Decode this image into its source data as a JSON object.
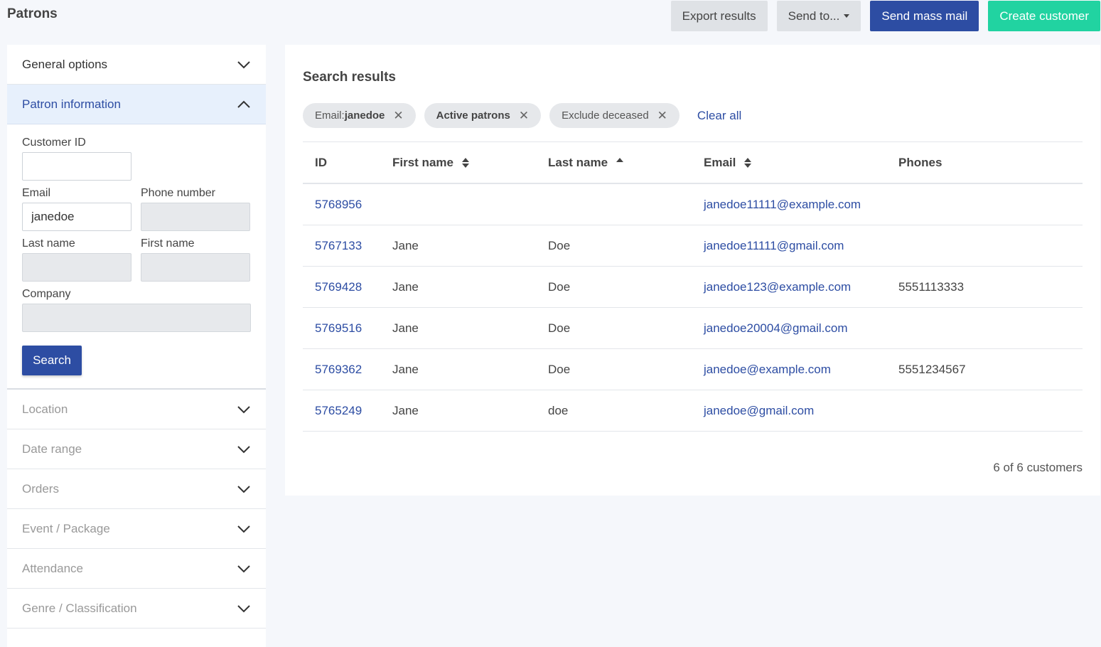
{
  "page_title": "Patrons",
  "actions": {
    "export": "Export results",
    "send_to": "Send to...",
    "mass_mail": "Send mass mail",
    "create": "Create customer"
  },
  "sidebar": {
    "general_options": "General options",
    "patron_information": "Patron information",
    "labels": {
      "customer_id": "Customer ID",
      "email": "Email",
      "phone": "Phone number",
      "last_name": "Last name",
      "first_name": "First name",
      "company": "Company"
    },
    "values": {
      "customer_id": "",
      "email": "janedoe",
      "phone": "",
      "last_name": "",
      "first_name": "",
      "company": ""
    },
    "search_button": "Search",
    "sections": [
      "Location",
      "Date range",
      "Orders",
      "Event / Package",
      "Attendance",
      "Genre / Classification"
    ]
  },
  "results": {
    "title": "Search results",
    "filters": [
      {
        "prefix": "Email: ",
        "bold": "janedoe"
      },
      {
        "prefix": "",
        "bold": "Active patrons"
      },
      {
        "prefix": "Exclude deceased",
        "bold": ""
      }
    ],
    "clear_all": "Clear all",
    "columns": {
      "id": "ID",
      "first_name": "First name",
      "last_name": "Last name",
      "email": "Email",
      "phones": "Phones"
    },
    "rows": [
      {
        "id": "5768956",
        "first": "",
        "last": "",
        "email": "janedoe11111@example.com",
        "phone": ""
      },
      {
        "id": "5767133",
        "first": "Jane",
        "last": "Doe",
        "email": "janedoe11111@gmail.com",
        "phone": ""
      },
      {
        "id": "5769428",
        "first": "Jane",
        "last": "Doe",
        "email": "janedoe123@example.com",
        "phone": "5551113333"
      },
      {
        "id": "5769516",
        "first": "Jane",
        "last": "Doe",
        "email": "janedoe20004@gmail.com",
        "phone": ""
      },
      {
        "id": "5769362",
        "first": "Jane",
        "last": "Doe",
        "email": "janedoe@example.com",
        "phone": "5551234567"
      },
      {
        "id": "5765249",
        "first": "Jane",
        "last": "doe",
        "email": "janedoe@gmail.com",
        "phone": ""
      }
    ],
    "count": "6 of 6 customers"
  }
}
